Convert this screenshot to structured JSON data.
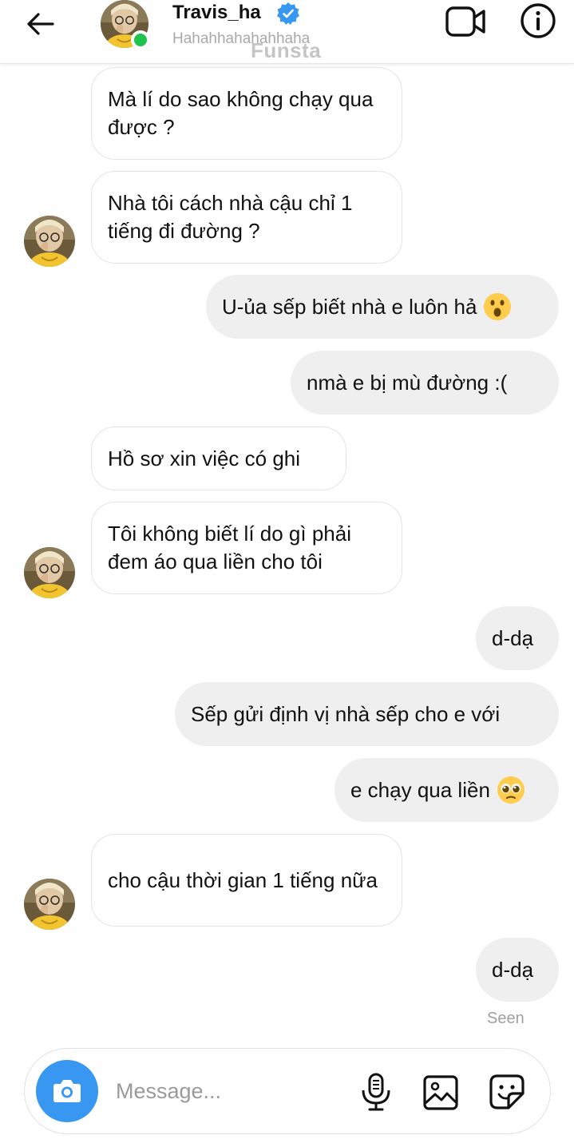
{
  "header": {
    "contact_name": "Travis_ha",
    "status_text": "Hahahhahahahhaha",
    "watermark": "Funsta"
  },
  "messages": [
    {
      "side": "incoming",
      "text": "Mà lí do sao không chạy qua được ?"
    },
    {
      "side": "incoming",
      "text": "Nhà tôi cách nhà cậu chỉ 1 tiếng đi đường ?"
    },
    {
      "side": "outgoing",
      "text": "U-ủa sếp biết nhà e luôn hả",
      "emoji": "astonished-face"
    },
    {
      "side": "outgoing",
      "text": "nmà e bị mù đường :("
    },
    {
      "side": "incoming",
      "text": "Hồ sơ xin việc có ghi"
    },
    {
      "side": "incoming",
      "text": "Tôi không biết lí do gì phải đem áo qua liền cho tôi"
    },
    {
      "side": "outgoing",
      "text": "d-dạ"
    },
    {
      "side": "outgoing",
      "text": "Sếp gửi định vị nhà sếp cho e với"
    },
    {
      "side": "outgoing",
      "text": "e chạy qua liền",
      "emoji": "pleading-face"
    },
    {
      "side": "incoming",
      "text": "cho cậu thời gian 1 tiếng nữa"
    },
    {
      "side": "outgoing",
      "text": "d-dạ"
    }
  ],
  "seen_label": "Seen",
  "composer": {
    "placeholder": "Message..."
  },
  "colors": {
    "accent": "#3897f0",
    "online": "#1fc24c",
    "outgoing_bubble": "#efefef"
  },
  "icons": [
    "back-arrow-icon",
    "verified-badge-icon",
    "video-call-icon",
    "info-icon",
    "camera-icon",
    "microphone-icon",
    "gallery-icon",
    "sticker-icon"
  ]
}
